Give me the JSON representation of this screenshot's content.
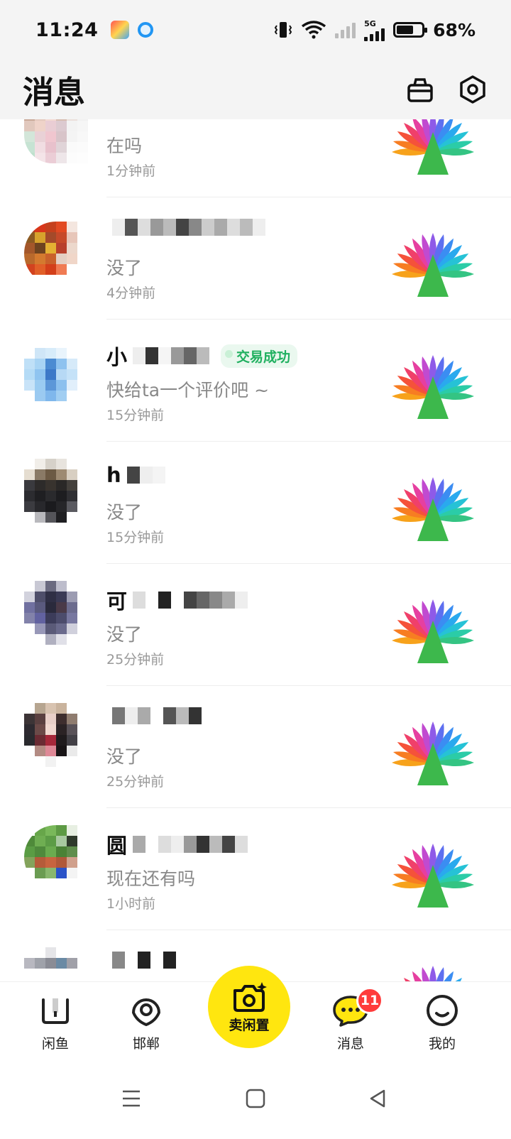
{
  "status_bar": {
    "time": "11:24",
    "battery_percent": "68%",
    "battery_level": 0.68,
    "network_label": "5G",
    "icons": [
      "app-notification-icon",
      "browser-notification-icon",
      "vibrate-icon",
      "wifi-icon",
      "signal-sim1-icon",
      "signal-5g-icon",
      "battery-icon"
    ]
  },
  "header": {
    "title": "消息",
    "actions": [
      "bag-icon",
      "settings-hex-icon"
    ]
  },
  "conversations": [
    {
      "name": "",
      "message": "在吗",
      "time": "1分钟前",
      "badge": ""
    },
    {
      "name": "",
      "message": "没了",
      "time": "4分钟前",
      "badge": ""
    },
    {
      "name": "小",
      "message": "快给ta一个评价吧 ~",
      "time": "15分钟前",
      "badge": "交易成功"
    },
    {
      "name": "h",
      "message": "没了",
      "time": "15分钟前",
      "badge": ""
    },
    {
      "name": "可",
      "message": "没了",
      "time": "25分钟前",
      "badge": ""
    },
    {
      "name": "",
      "message": "没了",
      "time": "25分钟前",
      "badge": ""
    },
    {
      "name": "圆",
      "message": "现在还有吗",
      "time": "1小时前",
      "badge": ""
    },
    {
      "name": "",
      "message": "",
      "time": "",
      "badge": ""
    }
  ],
  "tabbar": {
    "home": "闲鱼",
    "city": "邯郸",
    "sell": "卖闲置",
    "messages": "消息",
    "messages_badge": "11",
    "me": "我的"
  },
  "colors": {
    "accent_yellow": "#ffe60f",
    "badge_red": "#ff3b3b",
    "success_green": "#20b060"
  }
}
